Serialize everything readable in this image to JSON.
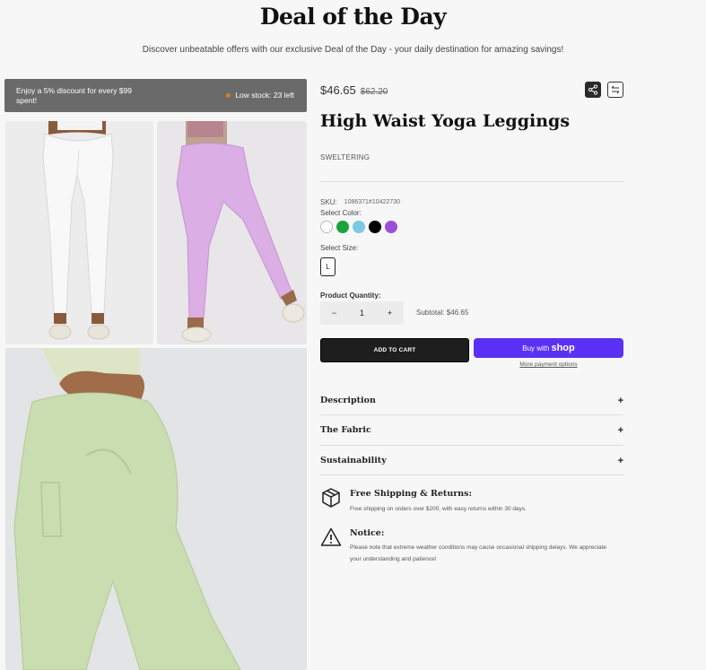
{
  "header": {
    "title": "Deal of the Day",
    "subtitle": "Discover unbeatable offers with our exclusive Deal of the Day - your daily destination for amazing savings!"
  },
  "promo": {
    "discount_text": "Enjoy a 5% discount for every $99 spent!",
    "stock_text": "Low stock: 23 left"
  },
  "gallery": {
    "images": [
      "white-leggings-front",
      "lilac-leggings-back",
      "green-leggings-back"
    ]
  },
  "product": {
    "price": "$46.65",
    "compare_price": "$62.20",
    "title": "High Waist Yoga Leggings",
    "brand": "SWELTERING",
    "sku_label": "SKU:",
    "sku_value": "1086371#10422730",
    "color_label": "Select Color:",
    "colors": [
      "#ffffff",
      "#1aa33a",
      "#7ec8e3",
      "#000000",
      "#9b4fd6"
    ],
    "size_label": "Select Size:",
    "sizes": [
      "L"
    ],
    "quantity_label": "Product Quantity:",
    "quantity": "1",
    "minus": "−",
    "plus": "+",
    "subtotal": "Subtotal: $46.65"
  },
  "actions": {
    "add_to_cart": "ADD TO CART",
    "buy_with": "Buy with",
    "shop_word": "shop",
    "more_payment": "More payment options"
  },
  "accordion": [
    {
      "label": "Description",
      "icon": "+"
    },
    {
      "label": "The Fabric",
      "icon": "+"
    },
    {
      "label": "Sustainability",
      "icon": "+"
    }
  ],
  "info": {
    "shipping_title": "Free Shipping & Returns:",
    "shipping_text": "Free shipping on orders over $200, with easy returns within 30 days.",
    "notice_title": "Notice:",
    "notice_text": "Please note that extreme weather conditions may cause occasional shipping delays. We appreciate your understanding and patience!"
  }
}
